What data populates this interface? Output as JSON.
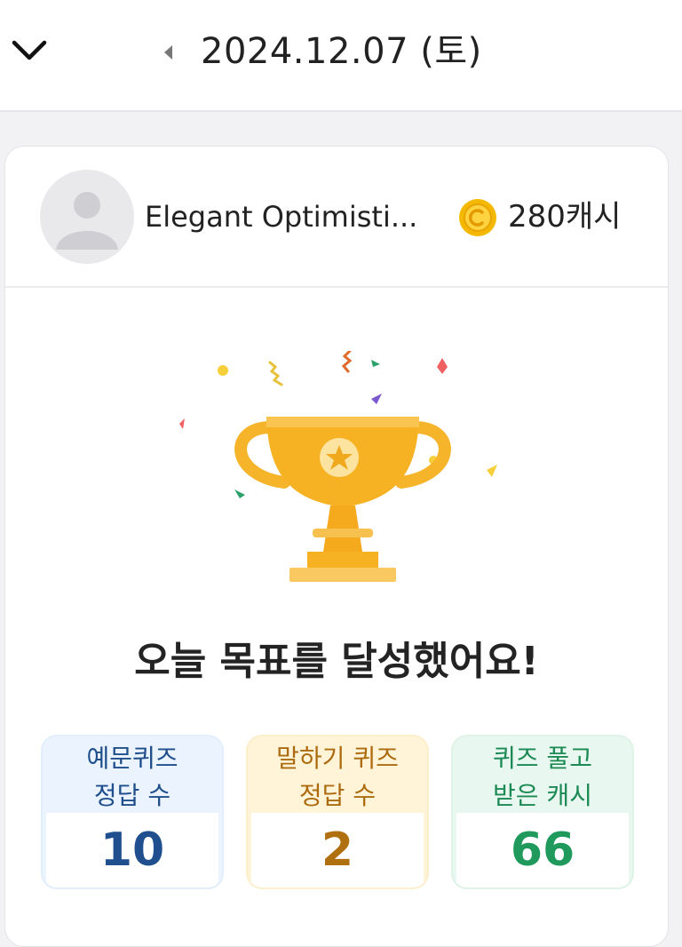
{
  "header": {
    "back_icon": "chevron-down-icon",
    "prev_icon": "caret-left-icon",
    "date": "2024.12.07 (토)"
  },
  "profile": {
    "username": "Elegant Optimisti...",
    "coin_icon": "coin-icon",
    "cash": "280캐시"
  },
  "headline": "오늘 목표를 달성했어요!",
  "stats": [
    {
      "label_line1": "예문퀴즈",
      "label_line2": "정답 수",
      "value": "10",
      "color": "#1f4f8f"
    },
    {
      "label_line1": "말하기 퀴즈",
      "label_line2": "정답 수",
      "value": "2",
      "color": "#b0700f"
    },
    {
      "label_line1": "퀴즈 풀고",
      "label_line2": "받은 캐시",
      "value": "66",
      "color": "#1f9a5c"
    }
  ],
  "colors": {
    "trophy": "#f7b224",
    "coin": "#f5b800",
    "background": "#f2f2f4"
  }
}
